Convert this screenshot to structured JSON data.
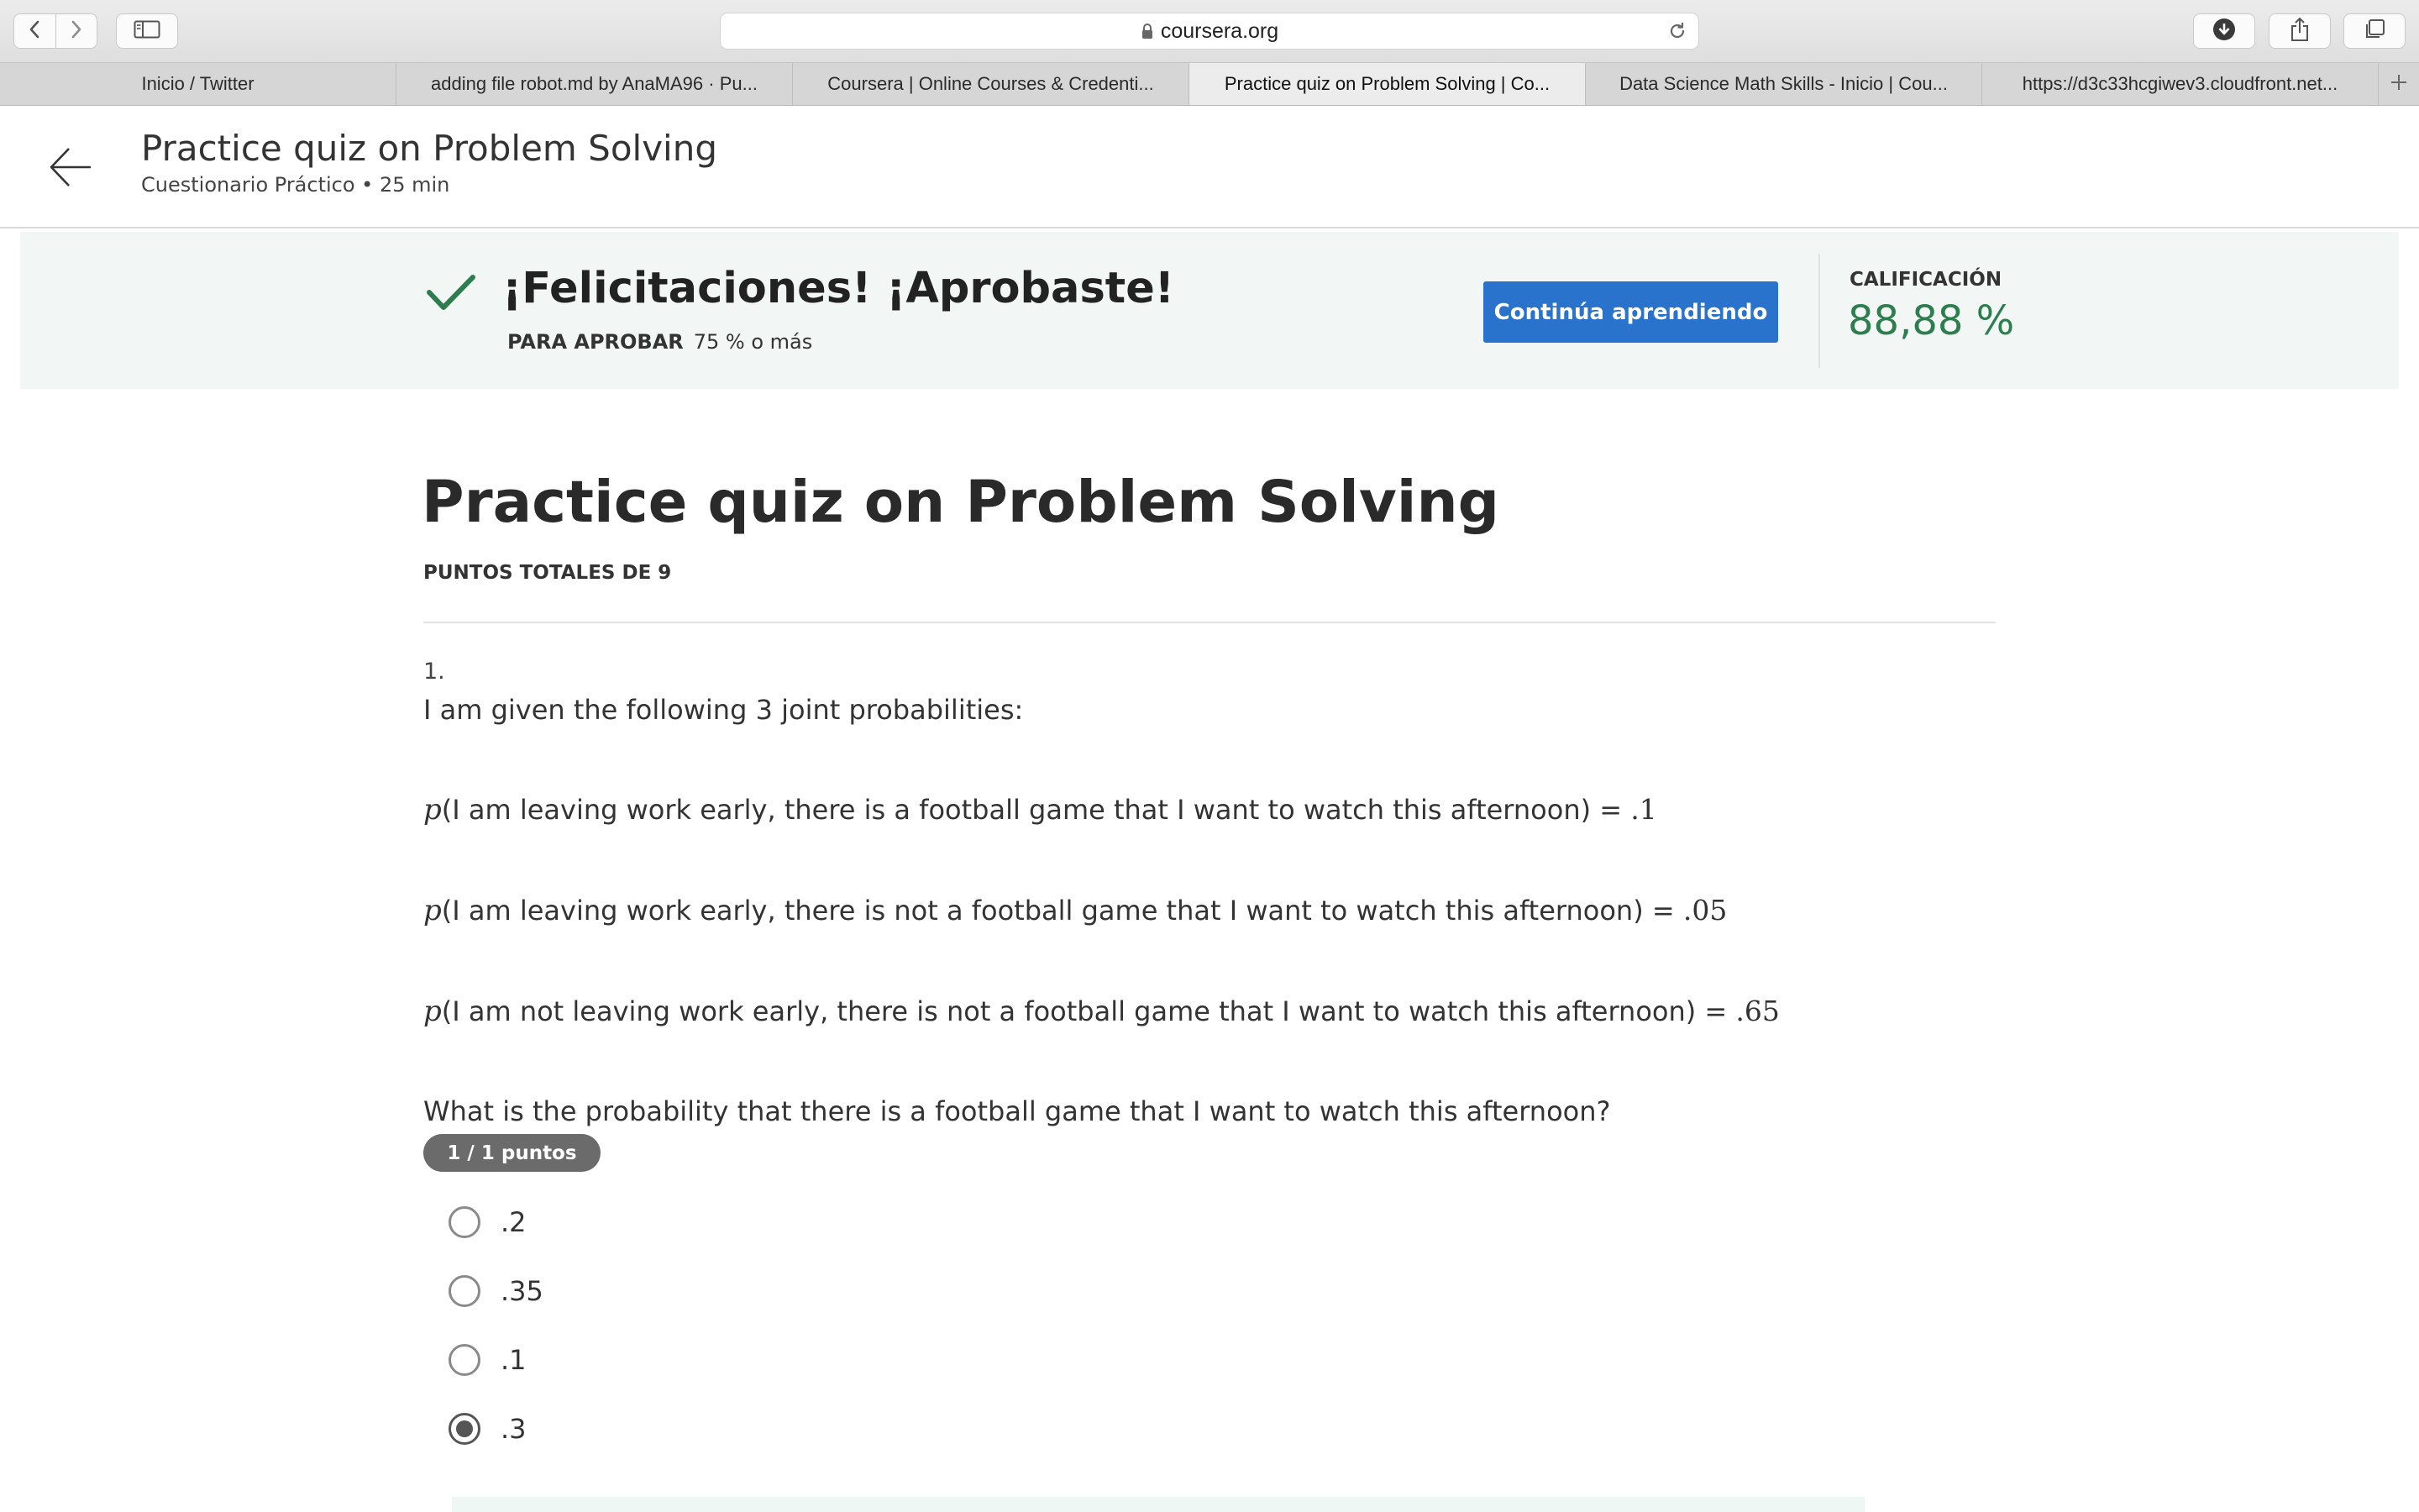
{
  "browser": {
    "address": "coursera.org",
    "tabs": [
      {
        "label": "Inicio / Twitter"
      },
      {
        "label": "adding file robot.md by AnaMA96 · Pu..."
      },
      {
        "label": "Coursera | Online Courses & Credenti..."
      },
      {
        "label": "Practice quiz on Problem Solving | Co...",
        "active": true
      },
      {
        "label": "Data Science Math Skills - Inicio | Cou..."
      },
      {
        "label": "https://d3c33hcgiwev3.cloudfront.net..."
      }
    ],
    "icons": [
      "back-icon",
      "forward-icon",
      "sidebar-icon",
      "lock-icon",
      "reload-icon",
      "download-icon",
      "share-icon",
      "tabs-overview-icon",
      "new-tab-icon"
    ]
  },
  "header": {
    "title": "Practice quiz on Problem Solving",
    "subtitle": "Cuestionario Práctico • 25 min"
  },
  "banner": {
    "title": "¡Felicitaciones! ¡Aprobaste!",
    "pass_label": "PARA APROBAR",
    "pass_value": "75 % o más",
    "continue_label": "Continúa aprendiendo",
    "grade_label": "CALIFICACIÓN",
    "grade_value": "88,88 %",
    "accent_color": "#2e7d4f",
    "button_color": "#2a73cc"
  },
  "quiz": {
    "title": "Practice quiz on Problem Solving",
    "total_points": "PUNTOS TOTALES DE 9",
    "question": {
      "number": "1.",
      "intro": "I am given the following 3 joint probabilities:",
      "probabilities": [
        {
          "symbol": "p",
          "text": "(I am leaving work early, there is a football game that I want to watch this afternoon) = ",
          "value": ".1"
        },
        {
          "symbol": "p",
          "text": "(I am leaving work early, there is not a football game that I want to watch this afternoon) = ",
          "value": ".05"
        },
        {
          "symbol": "p",
          "text": "(I am not leaving work early, there is not a football game that I want to watch this afternoon) = ",
          "value": ".65"
        }
      ],
      "prompt": "What is the probability that there is a football game that I want to watch this afternoon?",
      "score": "1 / 1 puntos",
      "options": [
        {
          "label": ".2",
          "selected": false
        },
        {
          "label": ".35",
          "selected": false
        },
        {
          "label": ".1",
          "selected": false
        },
        {
          "label": ".3",
          "selected": true
        }
      ]
    }
  }
}
